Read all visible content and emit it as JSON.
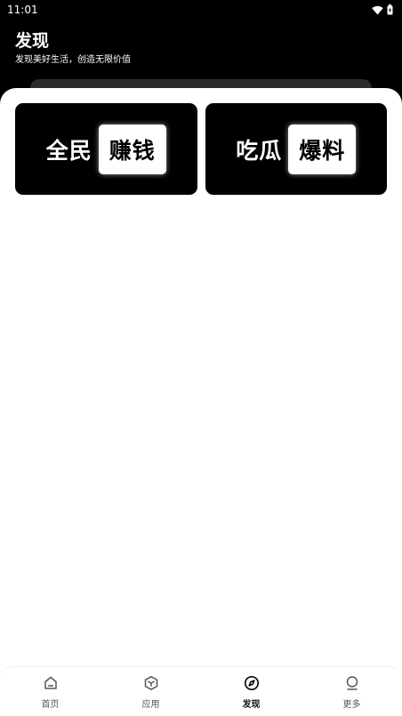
{
  "status_bar": {
    "time": "11:01"
  },
  "header": {
    "title": "发现",
    "subtitle": "发现美好生活，创造无限价值"
  },
  "banners": [
    {
      "lead": "全民",
      "box": "赚钱"
    },
    {
      "lead": "吃瓜",
      "box": "爆料"
    }
  ],
  "bottom_nav": {
    "items": [
      {
        "label": "首页",
        "icon": "home-icon"
      },
      {
        "label": "应用",
        "icon": "cube-icon"
      },
      {
        "label": "发现",
        "icon": "compass-icon",
        "active": true
      },
      {
        "label": "更多",
        "icon": "user-icon"
      }
    ]
  },
  "colors": {
    "header_bg": "#000000",
    "active": "#111111",
    "inactive": "#555555"
  }
}
